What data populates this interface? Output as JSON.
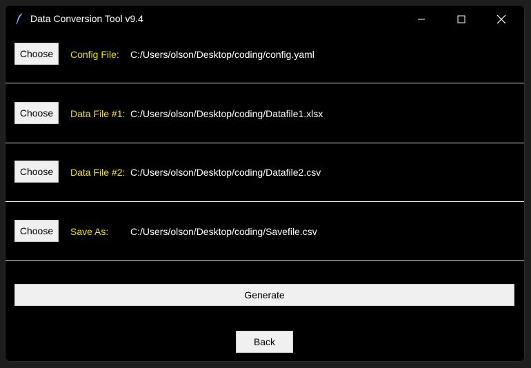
{
  "window": {
    "title": "Data Conversion Tool v9.4"
  },
  "rows": [
    {
      "button": "Choose",
      "label": "Config File:",
      "path": "C:/Users/olson/Desktop/coding/config.yaml"
    },
    {
      "button": "Choose",
      "label": "Data File #1:",
      "path": "C:/Users/olson/Desktop/coding/Datafile1.xlsx"
    },
    {
      "button": "Choose",
      "label": "Data File #2:",
      "path": "C:/Users/olson/Desktop/coding/Datafile2.csv"
    },
    {
      "button": "Choose",
      "label": "Save As:",
      "path": "C:/Users/olson/Desktop/coding/Savefile.csv"
    }
  ],
  "actions": {
    "generate": "Generate",
    "back": "Back"
  },
  "colors": {
    "label": "#f2e400",
    "text": "#ffffff",
    "background": "#000000",
    "button": "#f0f0f0"
  }
}
